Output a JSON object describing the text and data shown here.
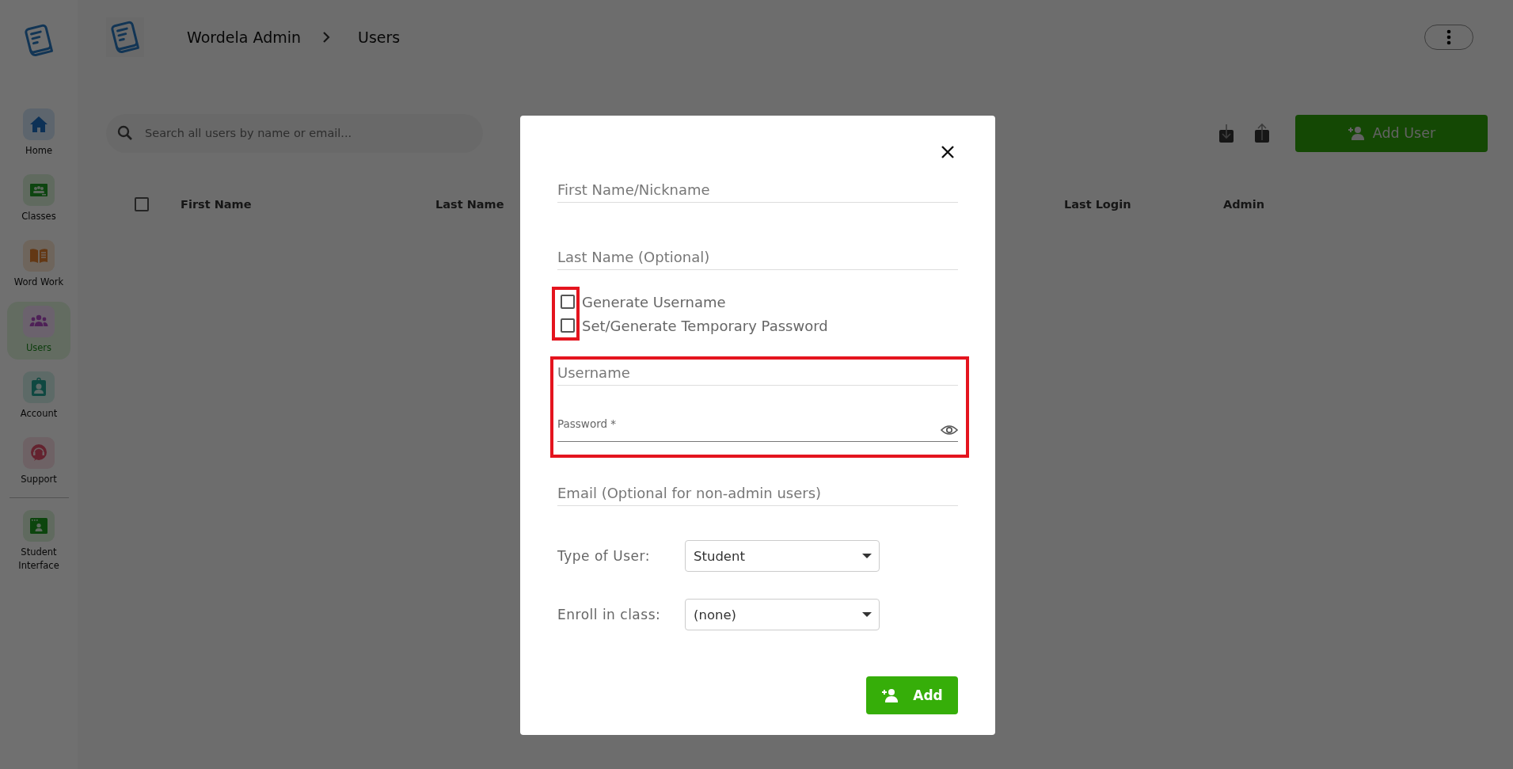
{
  "sidebar": {
    "items": [
      {
        "label": "Home",
        "selected": false
      },
      {
        "label": "Classes",
        "selected": false
      },
      {
        "label": "Word Work",
        "selected": false
      },
      {
        "label": "Users",
        "selected": true
      },
      {
        "label": "Account",
        "selected": false
      },
      {
        "label": "Support",
        "selected": false
      },
      {
        "label": "Student Interface",
        "selected": false,
        "divider_before": true
      }
    ]
  },
  "header": {
    "breadcrumb": [
      "Wordela Admin",
      "Users"
    ]
  },
  "toolbar": {
    "search": {
      "placeholder": "Search all users by name or email..."
    },
    "add_button": "Add User"
  },
  "table": {
    "select_all_checked": false,
    "columns": [
      "First Name",
      "Last Name",
      "Last Login",
      "Admin"
    ]
  },
  "dialog": {
    "items": [
      {
        "kind": "text",
        "placeholder": "First Name/Nickname"
      },
      {
        "kind": "text",
        "placeholder": "Last Name (Optional)"
      },
      {
        "kind": "checkboxes",
        "highlighted": true,
        "options": [
          {
            "label": "Generate Username",
            "checked": false
          },
          {
            "label": "Set/Generate Temporary Password",
            "checked": false
          }
        ]
      },
      {
        "kind": "group",
        "highlighted": true,
        "fields": [
          {
            "kind": "text",
            "placeholder": "Username"
          },
          {
            "kind": "password",
            "label": "Password *"
          }
        ]
      },
      {
        "kind": "text",
        "placeholder": "Email (Optional for non-admin users)"
      },
      {
        "kind": "select",
        "label": "Type of User:",
        "value": "Student"
      },
      {
        "kind": "select",
        "label": "Enroll in class:",
        "value": "(none)"
      }
    ],
    "submit": "Add"
  }
}
